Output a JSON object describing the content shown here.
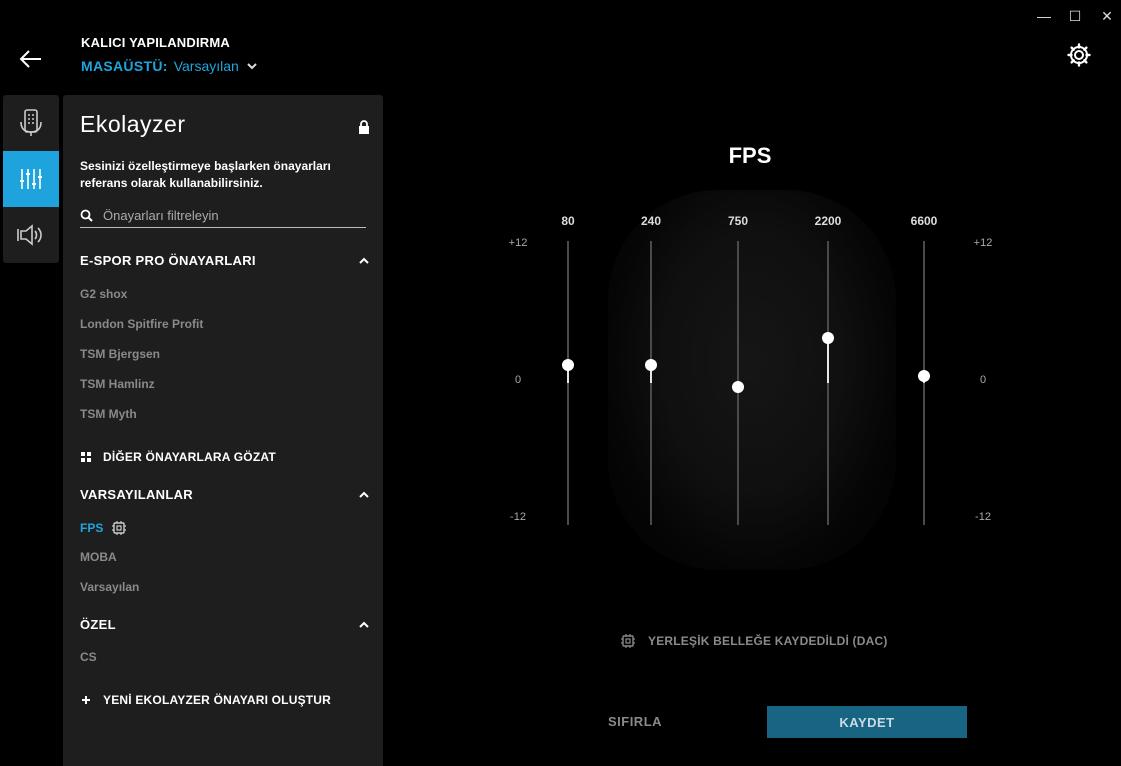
{
  "window_controls": {
    "minimize": "—",
    "maximize": "☐",
    "close": "✕"
  },
  "header": {
    "title": "KALICI YAPILANDIRMA",
    "profile_label": "MASAÜSTÜ:",
    "profile_value": "Varsayılan"
  },
  "rail": {
    "items": [
      {
        "icon": "device-icon",
        "active": false
      },
      {
        "icon": "equalizer-icon",
        "active": true
      },
      {
        "icon": "speaker-icon",
        "active": false
      }
    ]
  },
  "panel": {
    "title": "Ekolayzer",
    "description": "Sesinizi özelleştirmeye başlarken önayarları referans olarak kullanabilirsiniz.",
    "search_placeholder": "Önayarları filtreleyin",
    "esports_header": "E-SPOR PRO ÖNAYARLARI",
    "esports_items": [
      "G2 shox",
      "London Spitfire Profit",
      "TSM Bjergsen",
      "TSM Hamlinz",
      "TSM Myth"
    ],
    "browse_label": "DİĞER ÖNAYARLARA GÖZAT",
    "defaults_header": "VARSAYILANLAR",
    "defaults_items": [
      "FPS",
      "MOBA",
      "Varsayılan"
    ],
    "custom_header": "ÖZEL",
    "custom_items": [
      "CS"
    ],
    "create_label": "YENİ EKOLAYZER ÖNAYARI OLUŞTUR"
  },
  "eq": {
    "title": "FPS",
    "db_top": "+12",
    "db_mid": "0",
    "db_bottom": "-12",
    "bands": [
      {
        "freq": "80",
        "gain": 1.5
      },
      {
        "freq": "240",
        "gain": 1.5
      },
      {
        "freq": "750",
        "gain": -0.3
      },
      {
        "freq": "2200",
        "gain": 3.8
      },
      {
        "freq": "6600",
        "gain": 0.6
      }
    ],
    "saved_label": "YERLEŞİK BELLEĞE KAYDEDİLDİ (DAC)",
    "reset_label": "SIFIRLA",
    "save_label": "KAYDET"
  },
  "colors": {
    "accent": "#1fa5dd",
    "panel": "#1e1e1e",
    "save_button": "#176582"
  }
}
